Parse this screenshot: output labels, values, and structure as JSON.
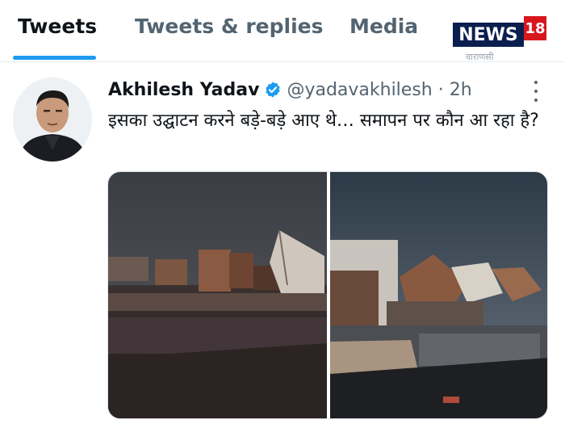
{
  "tabs": [
    {
      "label": "Tweets",
      "active": true
    },
    {
      "label": "Tweets & replies",
      "active": false
    },
    {
      "label": "Media",
      "active": false
    }
  ],
  "logo": {
    "word": "NEWS",
    "number": "18",
    "sub": "वाराणसी"
  },
  "tweet": {
    "name": "Akhilesh Yadav",
    "handle": "@yadavakhilesh · 2h",
    "text": "इसका उद्घाटन करने बड़े-बड़े आए थे… समापन पर कौन आ रहा है?",
    "verified": true
  },
  "colors": {
    "accent": "#1d9bf0",
    "text": "#0f1419",
    "muted": "#536471",
    "logo_blue": "#0b1f4f",
    "logo_red": "#d8161e"
  },
  "icons": [
    "verified-badge-icon",
    "more-options-icon"
  ]
}
